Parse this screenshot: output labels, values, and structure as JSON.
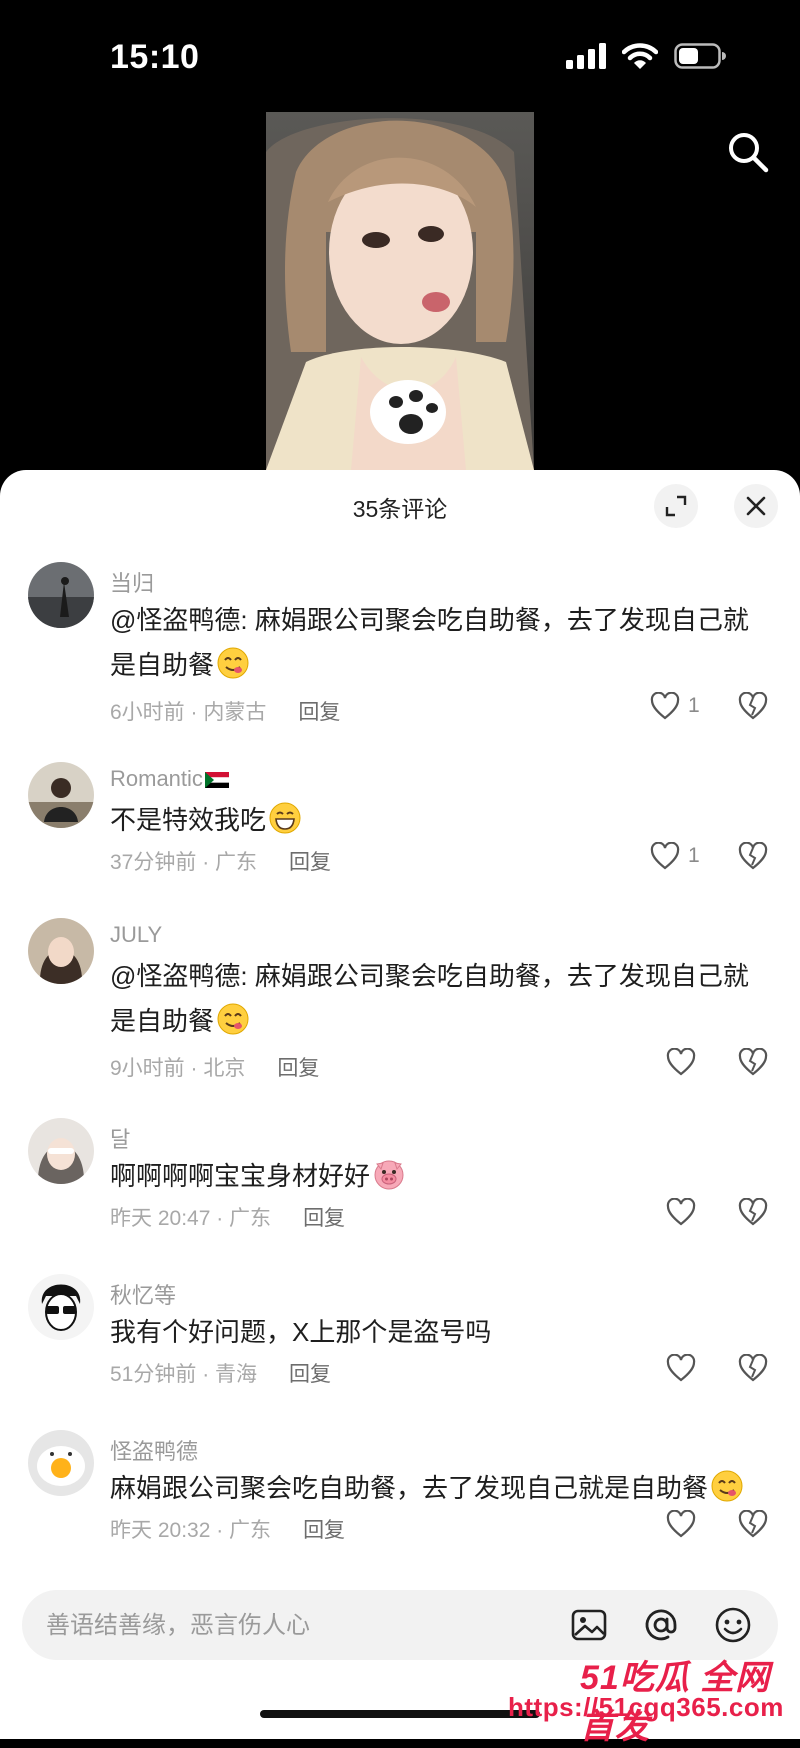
{
  "status_bar": {
    "time": "15:10"
  },
  "sheet": {
    "title": "35条评论"
  },
  "comments": [
    {
      "user": "当归",
      "text": "@怪盗鸭德: 麻娟跟公司聚会吃自助餐，去了发现自己就是自助餐",
      "emoji": "yum-face",
      "time_loc": "6小时前 · 内蒙古",
      "reply": "回复",
      "likes": "1"
    },
    {
      "user": "Romantic",
      "user_flag": "sudan-flag",
      "text": "不是特效我吃",
      "emoji": "grin-face",
      "time_loc": "37分钟前 · 广东",
      "reply": "回复",
      "likes": "1"
    },
    {
      "user": "JULY",
      "text": "@怪盗鸭德: 麻娟跟公司聚会吃自助餐，去了发现自己就是自助餐",
      "emoji": "yum-face",
      "time_loc": "9小时前 · 北京",
      "reply": "回复",
      "likes": ""
    },
    {
      "user": "달",
      "text": "啊啊啊啊宝宝身材好好",
      "emoji": "pig-face",
      "time_loc": "昨天 20:47 · 广东",
      "reply": "回复",
      "likes": ""
    },
    {
      "user": "秋忆等",
      "text": "我有个好问题，X上那个是盗号吗",
      "emoji": "",
      "time_loc": "51分钟前 · 青海",
      "reply": "回复",
      "likes": ""
    },
    {
      "user": "怪盗鸭德",
      "text": "麻娟跟公司聚会吃自助餐，去了发现自己就是自助餐",
      "emoji": "yum-face",
      "time_loc": "昨天 20:32 · 广东",
      "reply": "回复",
      "likes": ""
    }
  ],
  "input": {
    "placeholder": "善语结善缘，恶言伤人心"
  },
  "watermark": {
    "line1": "51吃瓜 全网首发",
    "line2": "https://51cgq365.com"
  }
}
